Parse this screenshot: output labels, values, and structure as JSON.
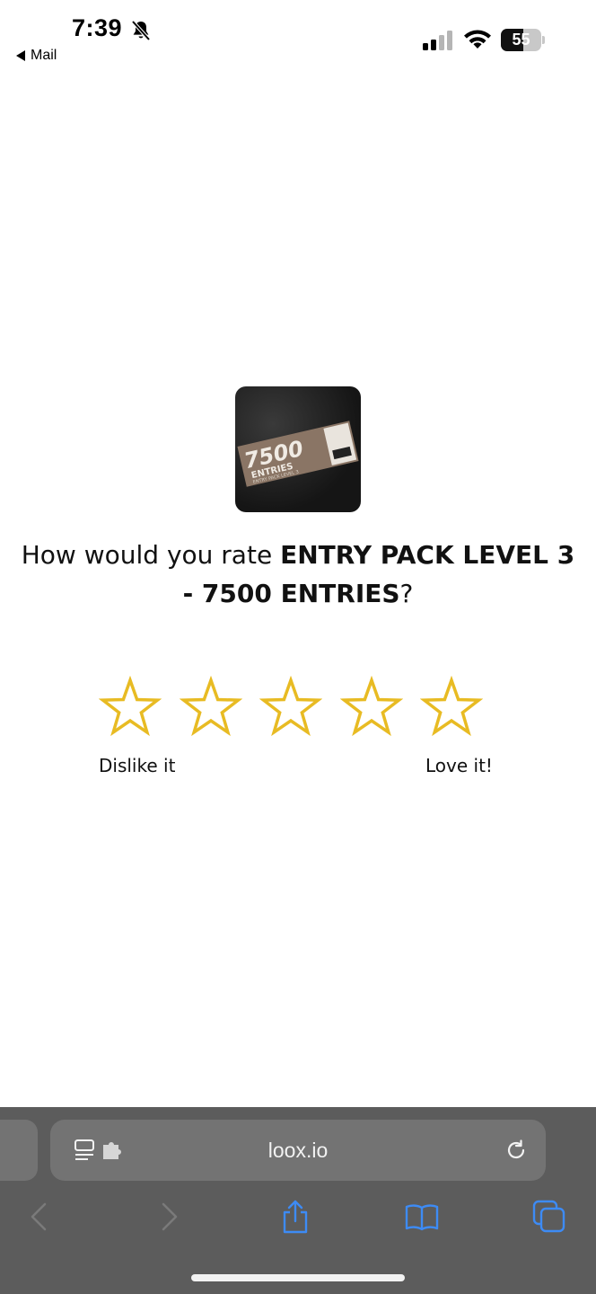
{
  "status_bar": {
    "time": "7:39",
    "back_app": "Mail",
    "battery_level": 55,
    "battery_label": "55"
  },
  "product": {
    "image_label_big": "7500",
    "image_label_sub": "ENTRIES",
    "image_label_small": "ENTRY PACK LEVEL 3"
  },
  "question": {
    "prefix": "How would you rate ",
    "product_name": "ENTRY PACK LEVEL 3 - 7500 ENTRIES",
    "suffix": "?"
  },
  "rating": {
    "star_count": 5,
    "selected": 0,
    "star_color": "#e8bb23",
    "low_label": "Dislike it",
    "high_label": "Love it!"
  },
  "browser": {
    "url": "loox.io",
    "accent": "#3d8bf5"
  }
}
